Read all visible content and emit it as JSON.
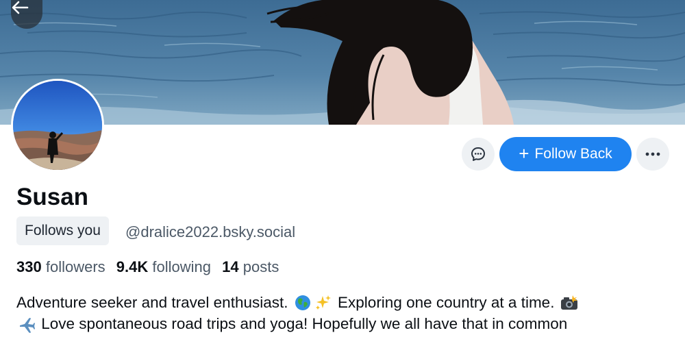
{
  "profile": {
    "display_name": "Susan",
    "follows_you_label": "Follows you",
    "handle": "@dralice2022.bsky.social",
    "avatar_icon": "avatar-photo",
    "banner_icon": "banner-photo"
  },
  "actions": {
    "message_icon": "chat-bubble-icon",
    "follow_label": "Follow Back",
    "follow_icon": "+",
    "more_icon": "ellipsis-icon",
    "back_icon": "arrow-left-icon"
  },
  "stats": {
    "followers_count": "330",
    "followers_label": "followers",
    "following_count": "9.4K",
    "following_label": "following",
    "posts_count": "14",
    "posts_label": "posts"
  },
  "bio": {
    "line1_part1": "Adventure seeker and travel enthusiast.",
    "line1_part2": "Exploring one country at a time.",
    "line2_part1": "Love spontaneous road trips and yoga! Hopefully we all have that in common",
    "emoji_globe": "globe-emoji",
    "emoji_sparkles": "sparkles-emoji",
    "emoji_camera": "camera-flash-emoji",
    "emoji_airplane": "airplane-emoji"
  },
  "colors": {
    "accent": "#1f83f0",
    "muted_text": "#4b5866",
    "chip_bg": "#eef1f4"
  }
}
